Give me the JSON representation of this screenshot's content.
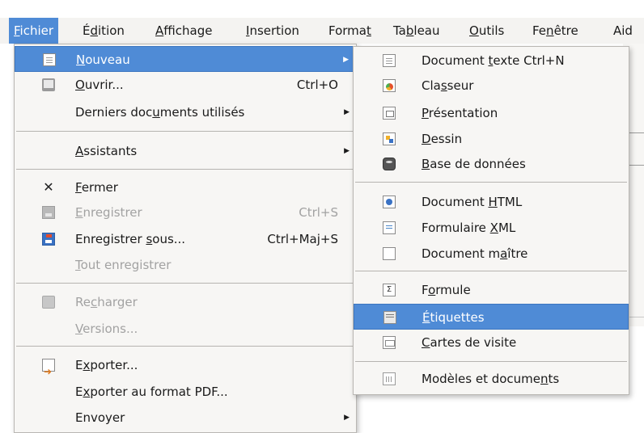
{
  "menubar": {
    "items": [
      {
        "pre": "",
        "u": "F",
        "post": "ichier"
      },
      {
        "pre": "É",
        "u": "d",
        "post": "ition"
      },
      {
        "pre": "",
        "u": "A",
        "post": "ffichage"
      },
      {
        "pre": "",
        "u": "I",
        "post": "nsertion"
      },
      {
        "pre": "Forma",
        "u": "t",
        "post": ""
      },
      {
        "pre": "Ta",
        "u": "b",
        "post": "leau"
      },
      {
        "pre": "",
        "u": "O",
        "post": "utils"
      },
      {
        "pre": "Fe",
        "u": "n",
        "post": "être"
      },
      {
        "pre": "Aid",
        "u": "",
        "post": ""
      }
    ]
  },
  "fichier_menu": {
    "items": [
      {
        "pre": "",
        "u": "N",
        "post": "ouveau",
        "shortcut": "",
        "icon": "new-document-icon"
      },
      {
        "pre": "",
        "u": "O",
        "post": "uvrir...",
        "shortcut": "Ctrl+O",
        "icon": "open-folder-icon"
      },
      {
        "pre": "Derniers doc",
        "u": "u",
        "post": "ments utilisés",
        "shortcut": "",
        "icon": ""
      },
      {
        "pre": "",
        "u": "A",
        "post": "ssistants",
        "shortcut": "",
        "icon": ""
      },
      {
        "pre": "",
        "u": "F",
        "post": "ermer",
        "shortcut": "",
        "icon": "close-x-icon"
      },
      {
        "pre": "",
        "u": "E",
        "post": "nregistrer",
        "shortcut": "Ctrl+S",
        "icon": "save-icon"
      },
      {
        "pre": "Enregistrer ",
        "u": "s",
        "post": "ous...",
        "shortcut": "Ctrl+Maj+S",
        "icon": "save-as-icon"
      },
      {
        "pre": "",
        "u": "T",
        "post": "out enregistrer",
        "shortcut": "",
        "icon": ""
      },
      {
        "pre": "Re",
        "u": "c",
        "post": "harger",
        "shortcut": "",
        "icon": "reload-icon"
      },
      {
        "pre": "",
        "u": "V",
        "post": "ersions...",
        "shortcut": "",
        "icon": ""
      },
      {
        "pre": "E",
        "u": "x",
        "post": "porter...",
        "shortcut": "",
        "icon": "export-icon"
      },
      {
        "pre": "E",
        "u": "x",
        "post": "porter au format PDF...",
        "shortcut": "",
        "icon": ""
      },
      {
        "pre": "Envoyer",
        "u": "",
        "post": "",
        "shortcut": "",
        "icon": ""
      }
    ]
  },
  "nouveau_menu": {
    "items": [
      {
        "pre": "Document ",
        "u": "t",
        "post": "exte Ctrl+N",
        "icon": "text-document-icon"
      },
      {
        "pre": "Cla",
        "u": "s",
        "post": "seur",
        "icon": "spreadsheet-icon"
      },
      {
        "pre": "",
        "u": "P",
        "post": "résentation",
        "icon": "presentation-icon"
      },
      {
        "pre": "",
        "u": "D",
        "post": "essin",
        "icon": "drawing-icon"
      },
      {
        "pre": "",
        "u": "B",
        "post": "ase de données",
        "icon": "database-icon"
      },
      {
        "pre": "Document ",
        "u": "H",
        "post": "TML",
        "icon": "html-document-icon"
      },
      {
        "pre": "Formulaire ",
        "u": "X",
        "post": "ML",
        "icon": "xml-form-icon"
      },
      {
        "pre": "Document m",
        "u": "a",
        "post": "ître",
        "icon": "master-document-icon"
      },
      {
        "pre": "F",
        "u": "o",
        "post": "rmule",
        "icon": "formula-icon"
      },
      {
        "pre": "",
        "u": "É",
        "post": "tiquettes",
        "icon": "labels-icon"
      },
      {
        "pre": "",
        "u": "C",
        "post": "artes de visite",
        "icon": "business-cards-icon"
      },
      {
        "pre": "Modèles et docume",
        "u": "n",
        "post": "ts",
        "icon": "templates-icon"
      }
    ]
  },
  "colors": {
    "highlight": "#4f8bd6",
    "menu_bg": "#f7f6f4",
    "disabled": "#a2a2a2"
  }
}
